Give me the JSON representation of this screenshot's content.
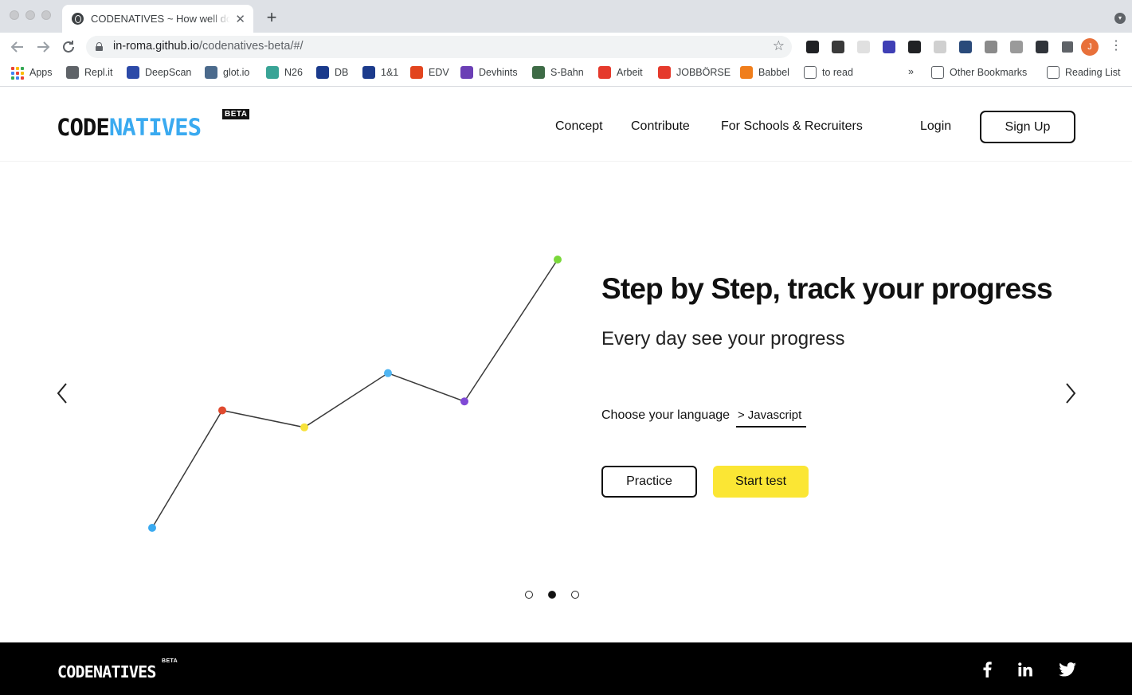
{
  "browser": {
    "tab_title": "CODENATIVES ~ How well do you know",
    "tab_close": "✕",
    "new_tab": "+",
    "url_host": "in-roma.github.io",
    "url_path": "/codenatives-beta/#/",
    "profile_initial": "J",
    "extensions": [
      {
        "name": "ext-icon-1",
        "color": "#202124"
      },
      {
        "name": "ext-icon-2",
        "color": "#3a3a3a"
      },
      {
        "name": "ext-icon-3",
        "color": "#e0e0e0"
      },
      {
        "name": "ext-icon-4",
        "color": "#3f3fb5"
      },
      {
        "name": "ext-icon-5",
        "color": "#202124"
      },
      {
        "name": "ext-icon-6",
        "color": "#d0d0d0"
      },
      {
        "name": "ext-icon-7",
        "color": "#2a4a7a"
      },
      {
        "name": "ext-icon-8",
        "color": "#8a8a8a"
      },
      {
        "name": "ext-icon-9",
        "color": "#9a9a9a"
      },
      {
        "name": "ext-icon-10",
        "color": "#30343a"
      },
      {
        "name": "puzzle-icon",
        "color": "#5f6368"
      }
    ],
    "bookmarks": [
      {
        "label": "Apps",
        "color": "#4285f4"
      },
      {
        "label": "Repl.it",
        "color": "#5f6368"
      },
      {
        "label": "DeepScan",
        "color": "#2c4aa8"
      },
      {
        "label": "glot.io",
        "color": "#4b6a8c"
      },
      {
        "label": "N26",
        "color": "#39a496"
      },
      {
        "label": "DB",
        "color": "#1a3a8c"
      },
      {
        "label": "1&1",
        "color": "#1c3b8c"
      },
      {
        "label": "EDV",
        "color": "#e2451f"
      },
      {
        "label": "Devhints",
        "color": "#6b3fb5"
      },
      {
        "label": "S-Bahn",
        "color": "#3e6b46"
      },
      {
        "label": "Arbeit",
        "color": "#e53a2c"
      },
      {
        "label": "JOBBÖRSE",
        "color": "#e53a2c"
      },
      {
        "label": "Babbel",
        "color": "#f07e1c"
      },
      {
        "label": "to read",
        "color": "folder"
      }
    ],
    "overflow": "»",
    "other_bookmarks": "Other Bookmarks",
    "reading_list": "Reading List"
  },
  "header": {
    "logo_code": "CODE",
    "logo_natives": "NATIVES",
    "beta": "BETA",
    "nav": [
      "Concept",
      "Contribute",
      "For Schools & Recruiters"
    ],
    "login": "Login",
    "signup": "Sign Up"
  },
  "hero": {
    "title": "Step by Step, track your progress",
    "subtitle": "Every day see your progress",
    "language_label": "Choose your language",
    "language_value": "Javascript",
    "practice": "Practice",
    "start_test": "Start test",
    "prev_arrow": "‹",
    "next_arrow": "›",
    "slides": 3,
    "active_slide": 1
  },
  "chart_data": {
    "type": "line",
    "title": "",
    "xlabel": "",
    "ylabel": "",
    "x": [
      1,
      2,
      3,
      4,
      5,
      6
    ],
    "series": [
      {
        "values": [
          1,
          4.94,
          4.37,
          6.19,
          5.24,
          10
        ],
        "point_colors": [
          "#3aaaf0",
          "#e04a2f",
          "#f7e23a",
          "#4fb5f2",
          "#8049d6",
          "#7ad83a"
        ]
      }
    ],
    "ylim": [
      1,
      10
    ],
    "grid": false,
    "axes_visible": false
  },
  "footer": {
    "logo": "CODENATIVES",
    "beta": "BETA",
    "social": [
      "facebook",
      "linkedin",
      "twitter"
    ]
  }
}
